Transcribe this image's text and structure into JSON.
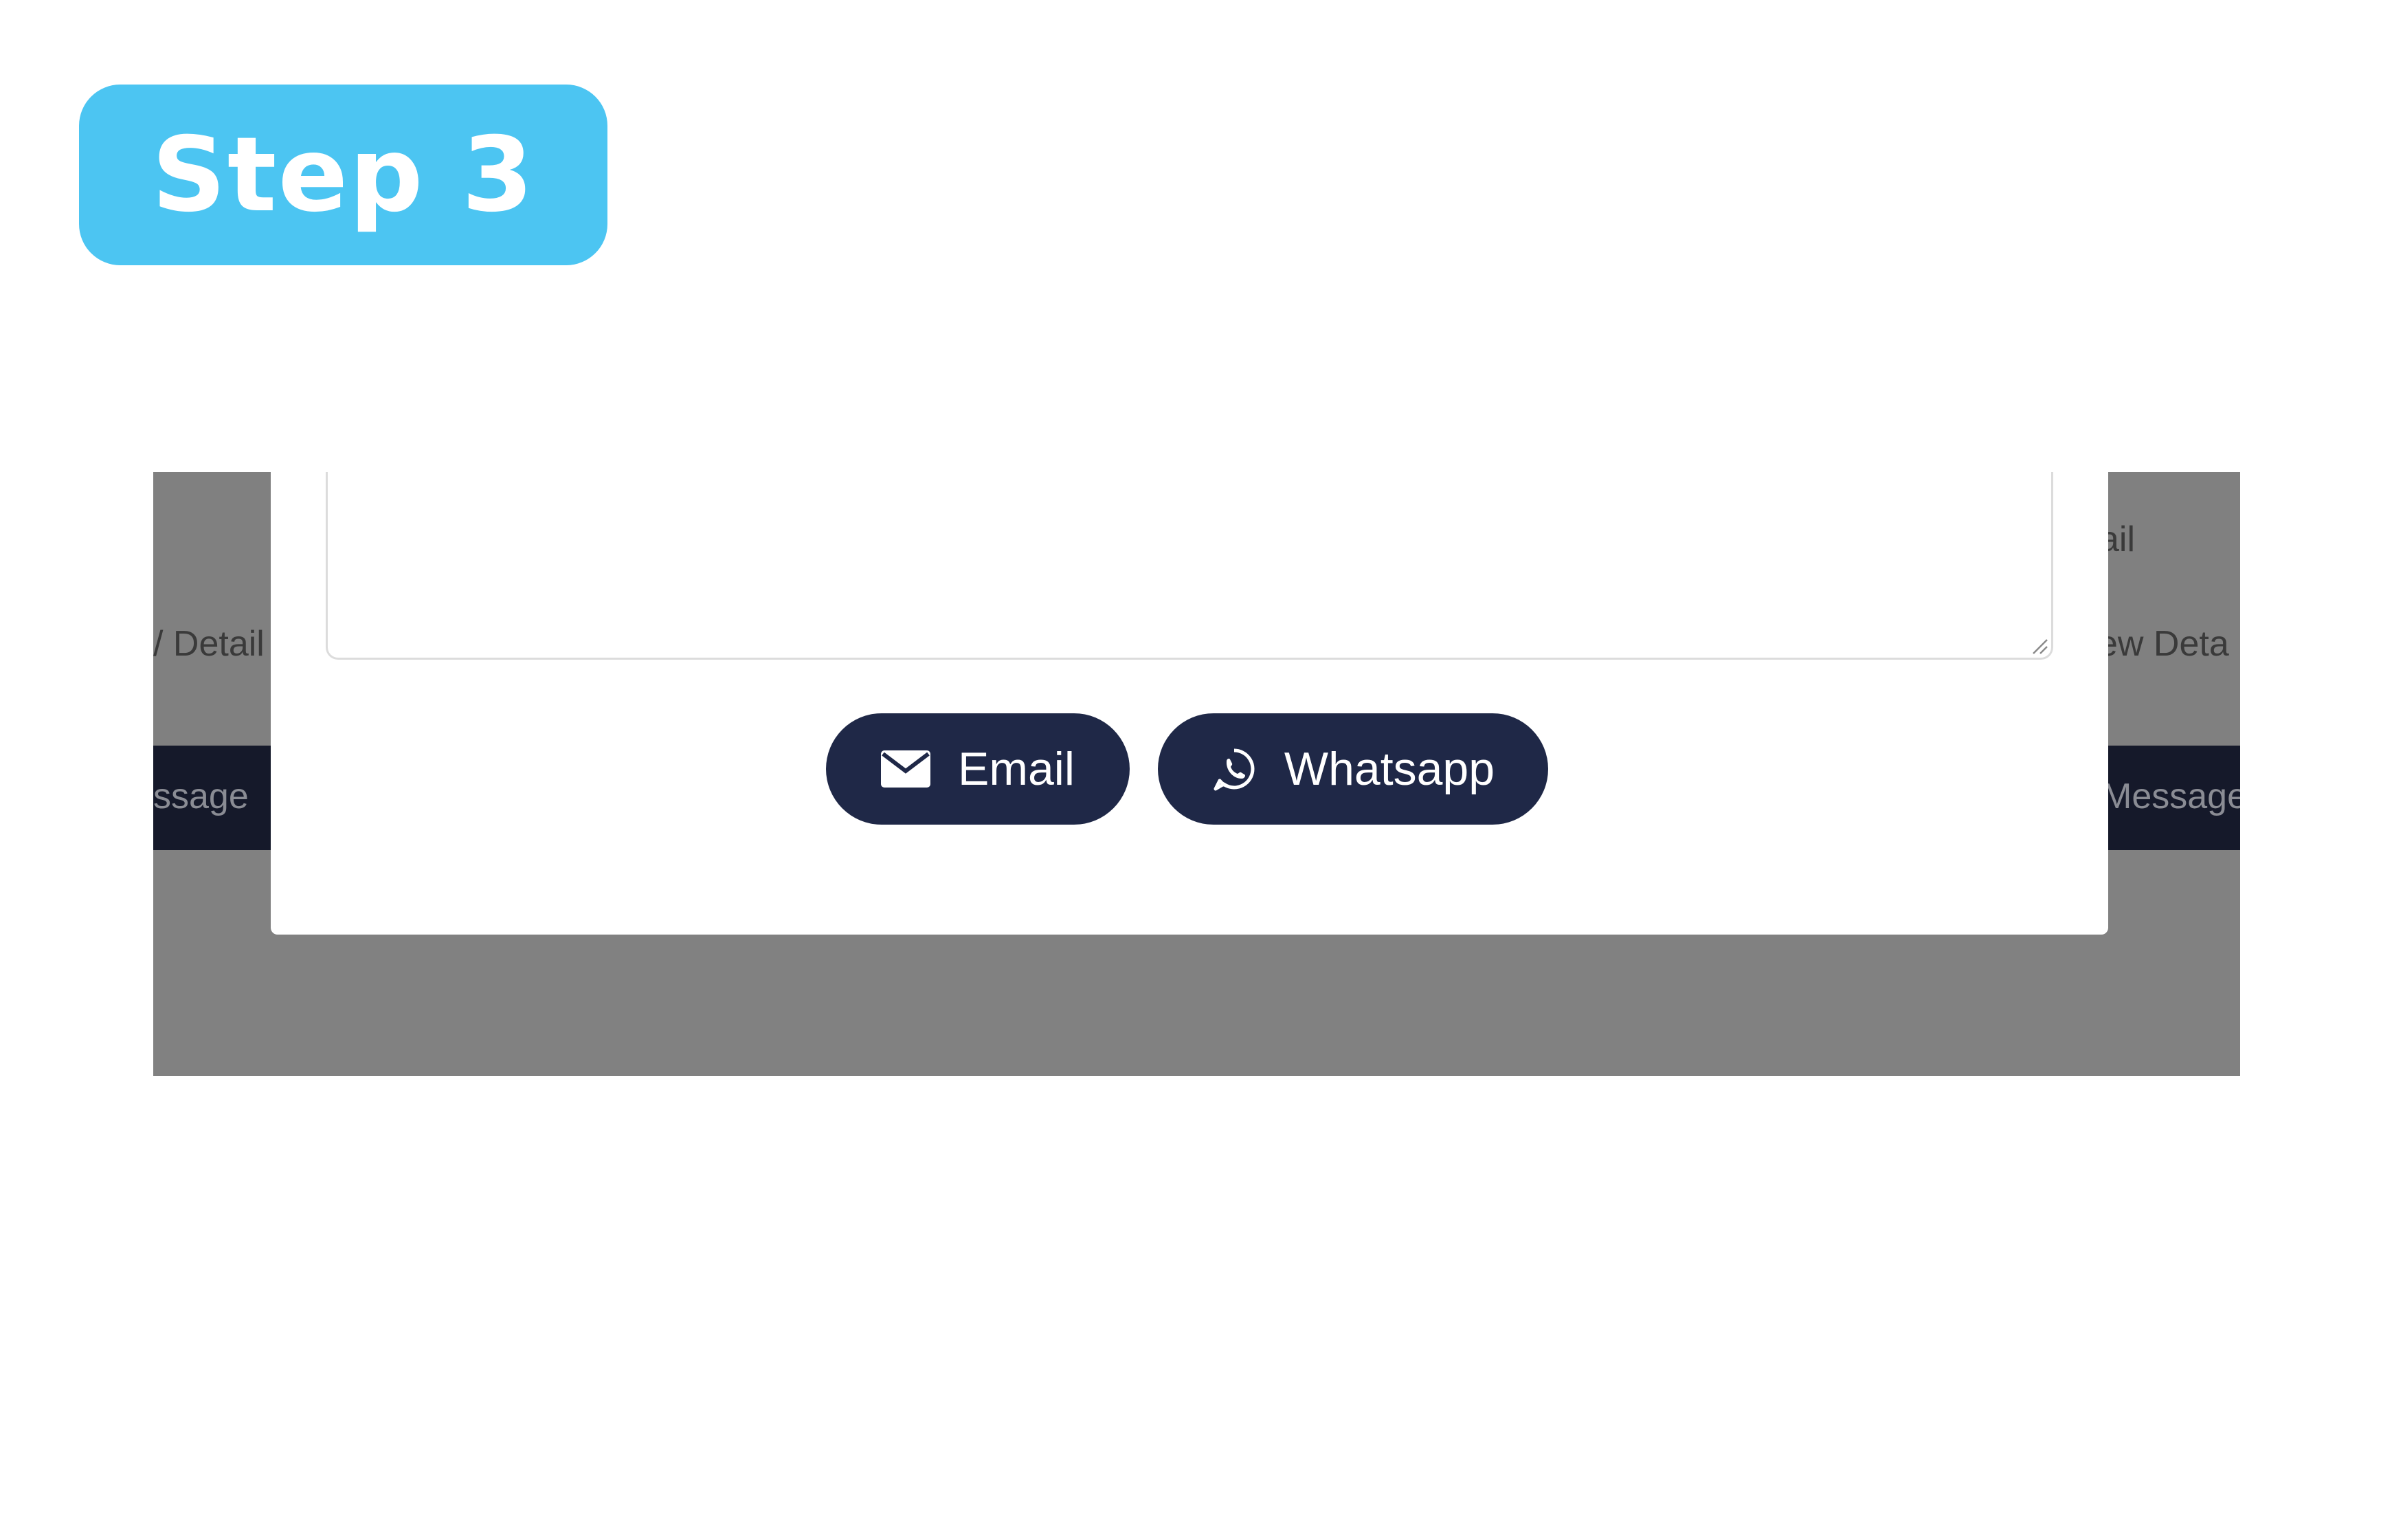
{
  "badge": {
    "text": "Step 3"
  },
  "background": {
    "left_detail": "/ Detail",
    "right_detail_top": "ail",
    "right_detail": "ew Deta",
    "left_message": "ssage",
    "right_message": "Message"
  },
  "modal": {
    "email_label": "Email",
    "email_icon": "envelope-icon",
    "whatsapp_label": "Whatsapp",
    "whatsapp_icon": "whatsapp-icon"
  },
  "colors": {
    "badge": "#4cc5f2",
    "button": "#1f2847",
    "overlay": "#808080"
  }
}
